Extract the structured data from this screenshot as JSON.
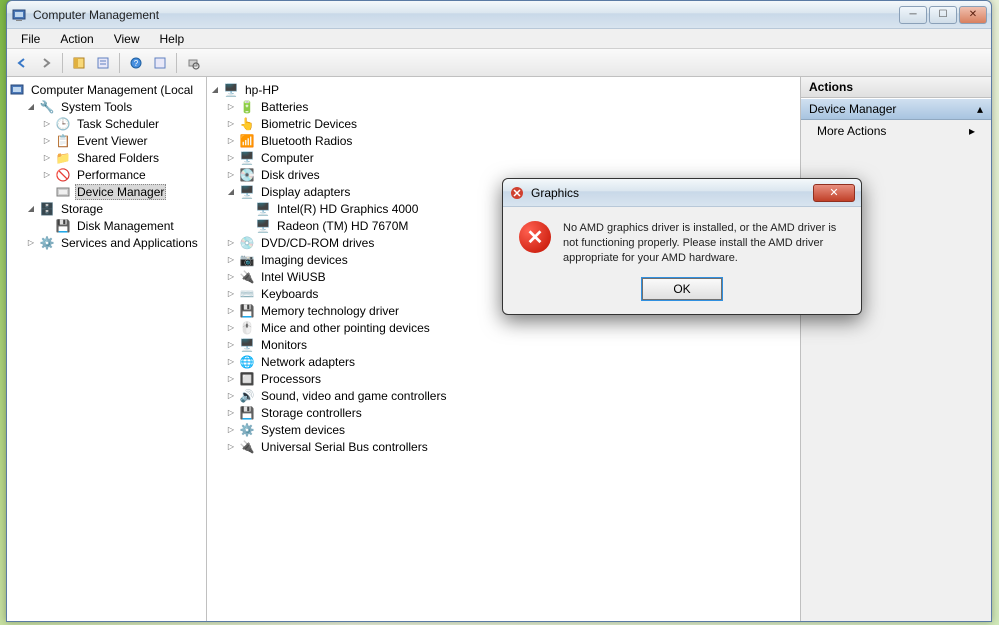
{
  "window": {
    "title": "Computer Management"
  },
  "menu": {
    "file": "File",
    "action": "Action",
    "view": "View",
    "help": "Help"
  },
  "left_tree": {
    "root": "Computer Management (Local",
    "system_tools": "System Tools",
    "task_scheduler": "Task Scheduler",
    "event_viewer": "Event Viewer",
    "shared_folders": "Shared Folders",
    "performance": "Performance",
    "device_manager": "Device Manager",
    "storage": "Storage",
    "disk_management": "Disk Management",
    "services_apps": "Services and Applications"
  },
  "center_tree": {
    "root": "hp-HP",
    "items": [
      "Batteries",
      "Biometric Devices",
      "Bluetooth Radios",
      "Computer",
      "Disk drives",
      "Display adapters",
      "DVD/CD-ROM drives",
      "Imaging devices",
      "Intel WiUSB",
      "Keyboards",
      "Memory technology driver",
      "Mice and other pointing devices",
      "Monitors",
      "Network adapters",
      "Processors",
      "Sound, video and game controllers",
      "Storage controllers",
      "System devices",
      "Universal Serial Bus controllers"
    ],
    "display_children": [
      "Intel(R) HD Graphics 4000",
      "Radeon (TM) HD 7670M"
    ]
  },
  "actions": {
    "header": "Actions",
    "section": "Device Manager",
    "more": "More Actions"
  },
  "dialog": {
    "title": "Graphics",
    "message": "No AMD graphics driver is installed, or the AMD driver is not functioning properly. Please install the AMD driver appropriate for your AMD hardware.",
    "ok": "OK"
  }
}
